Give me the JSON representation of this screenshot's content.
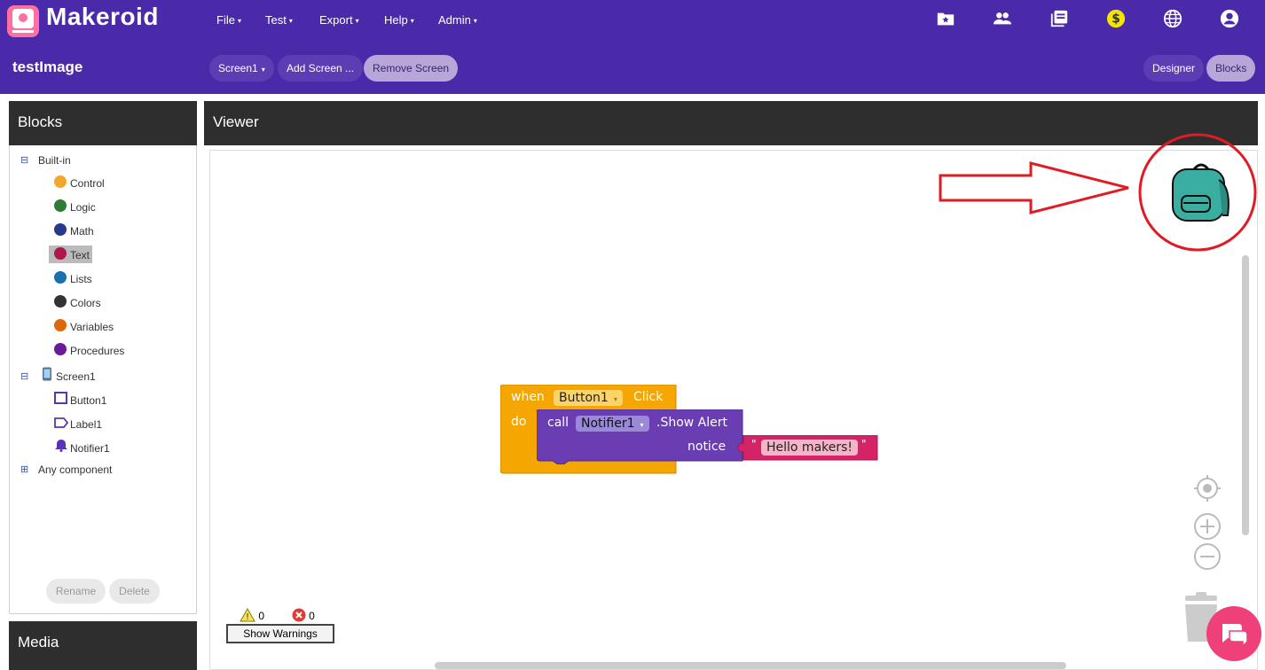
{
  "brand": {
    "name": "Makeroid"
  },
  "menu": [
    {
      "label": "File"
    },
    {
      "label": "Test"
    },
    {
      "label": "Export"
    },
    {
      "label": "Help"
    },
    {
      "label": "Admin"
    }
  ],
  "top_icons": [
    "star-folder-icon",
    "people-icon",
    "library-icon",
    "coin-icon",
    "globe-icon",
    "account-icon"
  ],
  "project": {
    "title": "testImage",
    "screen_select": "Screen1",
    "add_screen": "Add Screen ...",
    "remove_screen": "Remove Screen",
    "designer": "Designer",
    "blocks": "Blocks"
  },
  "blocks_panel": {
    "title": "Blocks",
    "builtin_label": "Built-in",
    "builtin_items": [
      {
        "label": "Control",
        "color": "#f2a72c"
      },
      {
        "label": "Logic",
        "color": "#2e7d32"
      },
      {
        "label": "Math",
        "color": "#253a8c"
      },
      {
        "label": "Text",
        "color": "#b0164e"
      },
      {
        "label": "Lists",
        "color": "#1a6fb0"
      },
      {
        "label": "Colors",
        "color": "#333333"
      },
      {
        "label": "Variables",
        "color": "#e0660e"
      },
      {
        "label": "Procedures",
        "color": "#6a1b9a"
      }
    ],
    "screen_label": "Screen1",
    "components": [
      {
        "label": "Button1"
      },
      {
        "label": "Label1"
      },
      {
        "label": "Notifier1"
      }
    ],
    "any_component": "Any component",
    "rename": "Rename",
    "delete": "Delete"
  },
  "media_panel": {
    "title": "Media"
  },
  "viewer": {
    "title": "Viewer",
    "event_block": {
      "when": "when",
      "component": "Button1",
      "event": "Click",
      "do": "do"
    },
    "call_block": {
      "call": "call",
      "component": "Notifier1",
      "method": ".Show Alert",
      "param": "notice"
    },
    "text_block": {
      "open_quote": "\"",
      "value": "Hello makers!",
      "close_quote": "\""
    },
    "warnings": {
      "warn_count": "0",
      "error_count": "0",
      "show_warnings": "Show Warnings"
    }
  },
  "colors": {
    "header": "#4a2aa8",
    "event_block": "#f5a600",
    "call_block": "#6a3db3",
    "text_block": "#d42366",
    "backpack": "#3aaea0",
    "annotation": "#e01b24"
  }
}
